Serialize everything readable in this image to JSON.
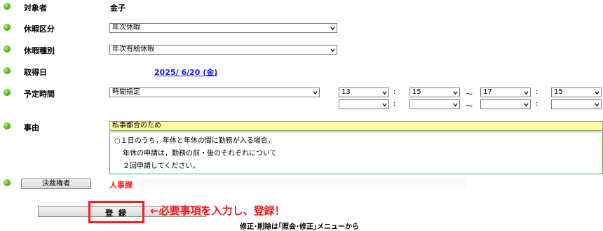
{
  "rows": {
    "target": {
      "label": "対象者",
      "value": "金子"
    },
    "leave_category": {
      "label": "休暇区分",
      "value": "年次休暇"
    },
    "leave_type": {
      "label": "休暇種別",
      "value": "年次有給休暇"
    },
    "date": {
      "label": "取得日",
      "value": "2025/ 6/20 (金)"
    },
    "planned_time": {
      "label": "予定時間",
      "mode": "時間指定",
      "start_hour": "13",
      "start_min": "15",
      "end_hour": "17",
      "end_min": "15",
      "start_hour_2": "",
      "start_min_2": "",
      "end_hour_2": "",
      "end_min_2": "",
      "colon": ":",
      "tilde": "～"
    },
    "reason": {
      "label": "事由",
      "value": "私事都合のため",
      "note": [
        "○１日のうち，年休と年休の間に勤務が入る場合，",
        "年休の申請は，勤務の前・後のそれぞれについて",
        "２回申請してください。"
      ]
    },
    "approver": {
      "button": "決裁権者",
      "value": "人事課"
    }
  },
  "footer": {
    "register_button": "登 録",
    "annotation": "←必要事項を入力し、登録！",
    "hint": "修正･削除は｢照会･修正｣メニューから"
  },
  "colors": {
    "accent_red": "#ff1a1a",
    "link_blue": "#1a1aff",
    "highlight": "#ffff99"
  }
}
